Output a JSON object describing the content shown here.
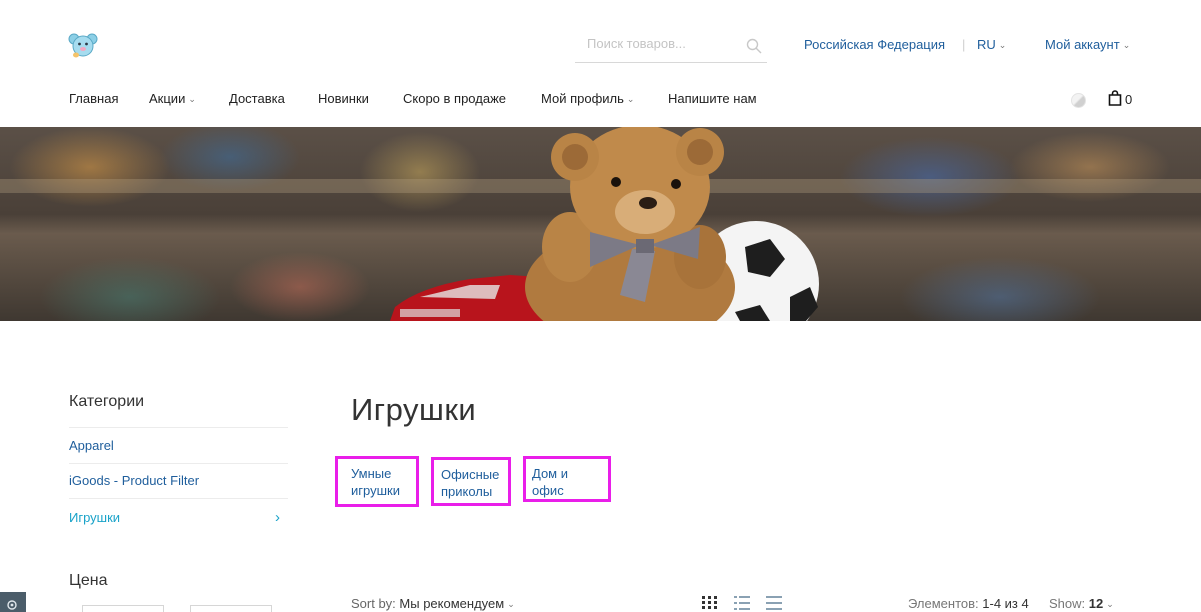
{
  "header": {
    "search_placeholder": "Поиск товаров...",
    "country": "Российская Федерация",
    "separator": "|",
    "language": "RU",
    "account": "Мой аккаунт",
    "cart_count": "0"
  },
  "nav": {
    "items": [
      {
        "label": "Главная"
      },
      {
        "label": "Акции"
      },
      {
        "label": "Доставка"
      },
      {
        "label": "Новинки"
      },
      {
        "label": "Скоро в продаже"
      },
      {
        "label": "Мой профиль"
      },
      {
        "label": "Напишите нам"
      }
    ]
  },
  "sidebar": {
    "categories_title": "Категории",
    "categories": [
      {
        "label": "Apparel"
      },
      {
        "label": "iGoods - Product Filter"
      },
      {
        "label": "Игрушки"
      }
    ],
    "price_title": "Цена"
  },
  "main": {
    "title": "Игрушки",
    "subcategories": [
      {
        "line1": "Умные",
        "line2": "игрушки"
      },
      {
        "line1": "Офисные",
        "line2": "приколы"
      },
      {
        "line1": "Дом и офис",
        "line2": ""
      }
    ],
    "sort_label": "Sort by:",
    "sort_value": "Мы рекомендуем",
    "count_label": "Элементов:",
    "count_value": "1-4 из 4",
    "show_label": "Show:",
    "show_value": "12"
  },
  "colors": {
    "link": "#1f5e9c",
    "active": "#1aa3c9",
    "highlight": "#e91ee9"
  }
}
